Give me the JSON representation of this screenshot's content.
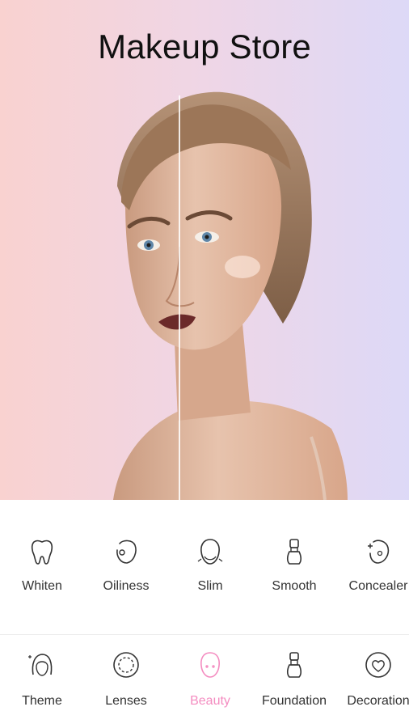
{
  "header": {
    "title": "Makeup Store"
  },
  "features": [
    {
      "label": "Whiten",
      "icon": "tooth-icon"
    },
    {
      "label": "Oiliness",
      "icon": "face-oil-icon"
    },
    {
      "label": "Slim",
      "icon": "face-slim-icon"
    },
    {
      "label": "Smooth",
      "icon": "brush-icon"
    },
    {
      "label": "Concealer",
      "icon": "concealer-icon"
    }
  ],
  "tabs": [
    {
      "label": "Theme",
      "icon": "woman-face-icon",
      "active": false
    },
    {
      "label": "Lenses",
      "icon": "lens-icon",
      "active": false
    },
    {
      "label": "Beauty",
      "icon": "face-icon",
      "active": true
    },
    {
      "label": "Foundation",
      "icon": "foundation-brush-icon",
      "active": false
    },
    {
      "label": "Decoration",
      "icon": "heart-sticker-icon",
      "active": false
    }
  ],
  "colors": {
    "accent": "#f48cc0",
    "text": "#333333"
  }
}
